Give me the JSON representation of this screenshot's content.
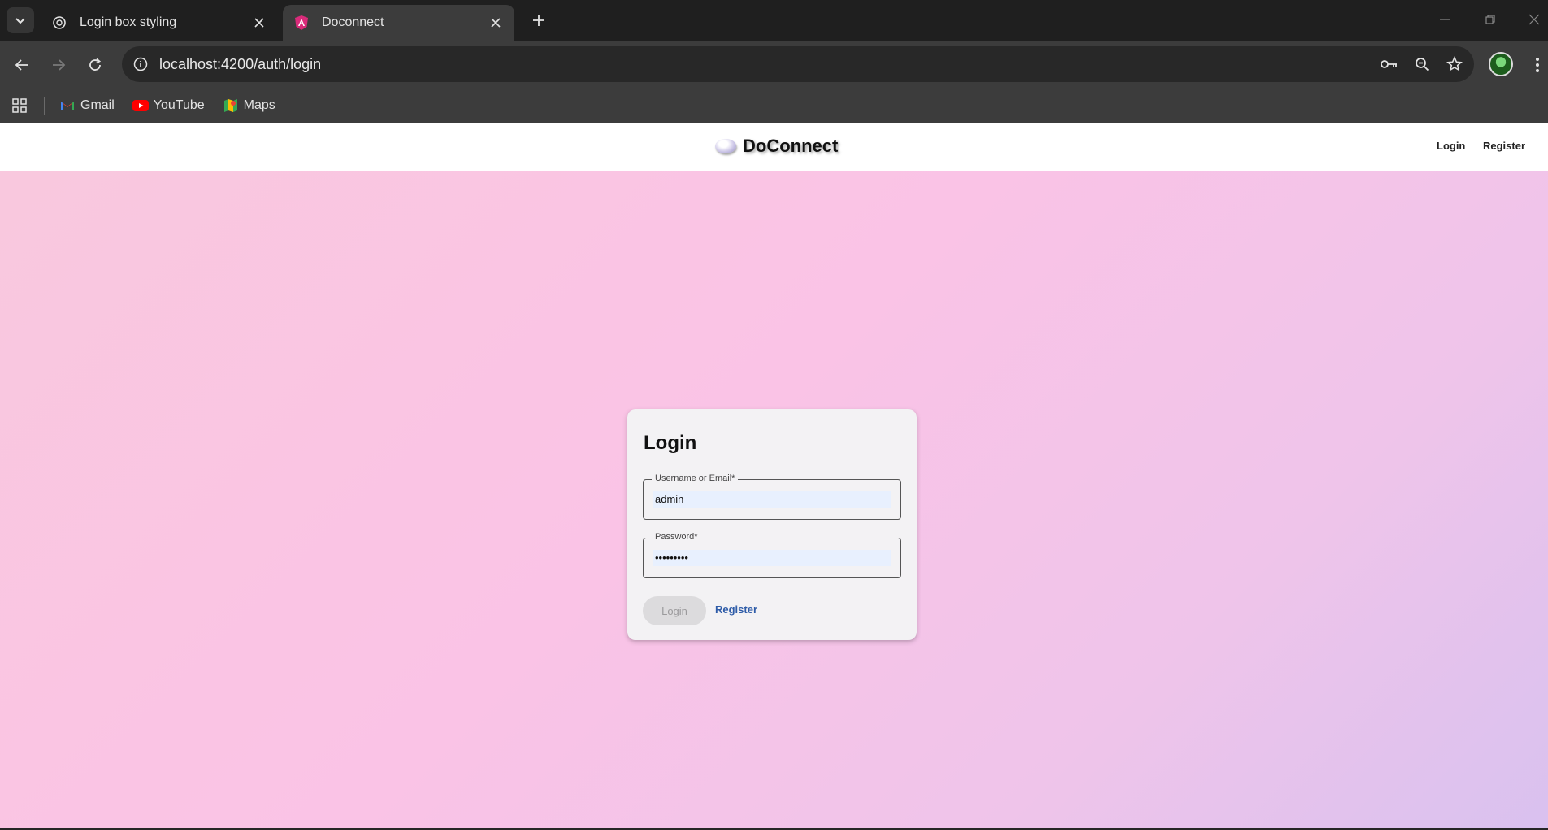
{
  "browser": {
    "tabs": [
      {
        "title": "Login box styling",
        "favicon": "openai-icon",
        "active": false
      },
      {
        "title": "Doconnect",
        "favicon": "angular-icon",
        "active": true
      }
    ],
    "url": "localhost:4200/auth/login",
    "bookmarks": [
      {
        "label": "Gmail",
        "icon": "gmail-icon"
      },
      {
        "label": "YouTube",
        "icon": "youtube-icon"
      },
      {
        "label": "Maps",
        "icon": "maps-icon"
      }
    ]
  },
  "app": {
    "brand": "DoConnect",
    "nav": {
      "login": "Login",
      "register": "Register"
    }
  },
  "login_form": {
    "title": "Login",
    "username_label": "Username or Email*",
    "username_value": "admin",
    "password_label": "Password*",
    "password_value": "•••••••••",
    "submit_label": "Login",
    "register_label": "Register"
  },
  "colors": {
    "gradient_start": "#f9c8de",
    "gradient_end": "#d9c1ef",
    "link": "#2e5ca8",
    "card_bg": "#f3f2f4"
  }
}
